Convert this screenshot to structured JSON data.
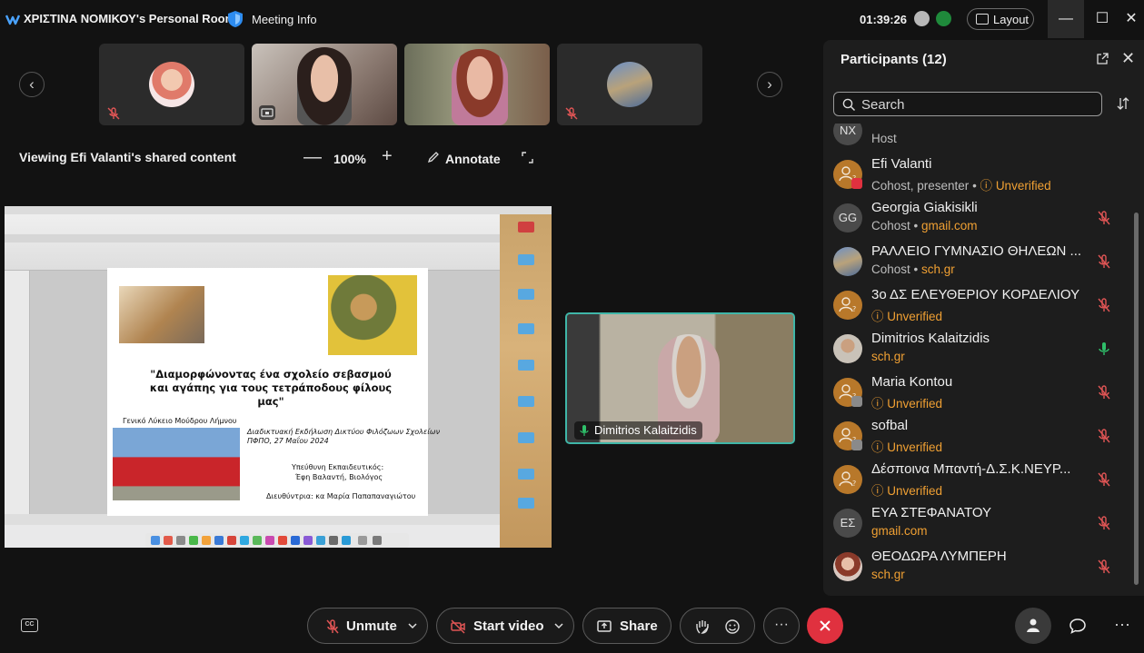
{
  "titlebar": {
    "room_title": "ΧΡΙΣΤΙΝΑ ΝΟΜΙΚΟΥ's Personal Room",
    "meeting_info": "Meeting Info",
    "time": "01:39:26",
    "layout_label": "Layout",
    "minimize": "—",
    "maximize": "☐",
    "close": "✕"
  },
  "thumbnails": {
    "prev_arrow": "‹",
    "next_arrow": "›"
  },
  "share_toolbar": {
    "viewing_text": "Viewing Efi Valanti's shared content",
    "zoom_minus": "—",
    "zoom_value": "100%",
    "zoom_plus": "+",
    "annotate_label": "Annotate"
  },
  "slide": {
    "title": "\"Διαμορφώνοντας ένα σχολείο σεβασμού και αγάπης για τους τετράποδους φίλους μας\"",
    "school": "Γενικό Λύκειο Μούδρου Λήμνου",
    "event_line1": "Διαδικτυακή Εκδήλωση Δικτύου Φιλόζωων Σχολείων",
    "event_line2": "ΠΦΠΟ, 27 Μαΐου 2024",
    "teacher_label": "Υπεύθυνη Εκπαιδευτικός:",
    "teacher_name": "Έφη Βαλαντή, Βιολόγος",
    "director": "Διευθύντρια: κα Μαρία Παπαπαναγιώτου"
  },
  "active_speaker": {
    "name": "Dimitrios Kalaitzidis"
  },
  "participants": {
    "title": "Participants (12)",
    "search_placeholder": "Search",
    "items": [
      {
        "initials": "ΝΧ",
        "name": "",
        "role": "Host",
        "domain": "",
        "unverified": ""
      },
      {
        "initials": "",
        "name": "Efi Valanti",
        "role": "Cohost, presenter",
        "domain": "",
        "unverified": "Unverified"
      },
      {
        "initials": "GG",
        "name": "Georgia Giakisikli",
        "role": "Cohost",
        "domain": "gmail.com",
        "unverified": ""
      },
      {
        "initials": "",
        "name": "ΡΑΛΛΕΙΟ ΓΥΜΝΑΣΙΟ ΘΗΛΕΩΝ ...",
        "role": "Cohost",
        "domain": "sch.gr",
        "unverified": ""
      },
      {
        "initials": "",
        "name": "3ο ΔΣ ΕΛΕΥΘΕΡΙΟΥ ΚΟΡΔΕΛΙΟΥ",
        "role": "",
        "domain": "",
        "unverified": "Unverified"
      },
      {
        "initials": "",
        "name": "Dimitrios Kalaitzidis",
        "role": "",
        "domain": "sch.gr",
        "unverified": ""
      },
      {
        "initials": "",
        "name": "Maria Kontou",
        "role": "",
        "domain": "",
        "unverified": "Unverified"
      },
      {
        "initials": "",
        "name": "sofbal",
        "role": "",
        "domain": "",
        "unverified": "Unverified"
      },
      {
        "initials": "",
        "name": "Δέσποινα Μπαντή-Δ.Σ.Κ.ΝΕΥΡ...",
        "role": "",
        "domain": "",
        "unverified": "Unverified"
      },
      {
        "initials": "ΕΣ",
        "name": "ΕΥΑ ΣΤΕΦΑΝΑΤΟΥ",
        "role": "",
        "domain": "gmail.com",
        "unverified": ""
      },
      {
        "initials": "",
        "name": "ΘΕΟΔΩΡΑ ΛΥΜΠΕΡΗ",
        "role": "",
        "domain": "sch.gr",
        "unverified": ""
      }
    ],
    "separator": " • "
  },
  "controls": {
    "cc_label": "CC",
    "unmute_label": "Unmute",
    "start_video_label": "Start video",
    "share_label": "Share",
    "more_label": "···"
  },
  "colors": {
    "accent_teal": "#3fb6a8",
    "leave_red": "#e0313f",
    "unverified_orange": "#f0a033",
    "mic_muted_red": "#e05555",
    "mic_active_green": "#2fbf6a"
  }
}
